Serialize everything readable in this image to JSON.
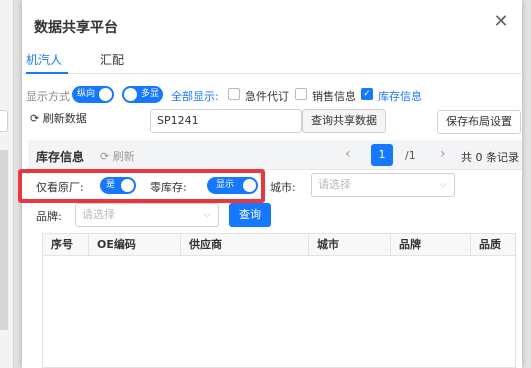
{
  "dialog": {
    "title": "数据共享平台",
    "close_icon": "close-icon"
  },
  "tabs": [
    {
      "label": "机汽人",
      "active": true
    },
    {
      "label": "汇配",
      "active": false
    }
  ],
  "display_options": {
    "mode_label": "显示方式",
    "mode_toggle": "纵向",
    "multi_toggle": "多显",
    "show_all": "全部显示:",
    "checkboxes": [
      {
        "label": "急件代订",
        "checked": false
      },
      {
        "label": "销售信息",
        "checked": false
      },
      {
        "label": "库存信息",
        "checked": true
      }
    ]
  },
  "toolbar": {
    "refresh_label": "刷新数据",
    "search_value": "SP1241",
    "query_label": "查询共享数据",
    "save_layout_label": "保存布局设置"
  },
  "inventory": {
    "title": "库存信息",
    "refresh_label": "刷新",
    "pagination": {
      "current": "1",
      "total": "/1",
      "summary": "共 0 条记录"
    },
    "filters": {
      "original_only_label": "仅看原厂:",
      "original_only_toggle": "是",
      "zero_stock_label": "零库存:",
      "zero_stock_toggle": "显示",
      "city_label": "城市:",
      "city_placeholder": "请选择",
      "brand_label": "品牌:",
      "brand_placeholder": "请选择",
      "search_button": "查询"
    },
    "columns": [
      "序号",
      "OE编码",
      "供应商",
      "城市",
      "品牌",
      "品质"
    ]
  },
  "colors": {
    "accent": "#1677ff",
    "highlight": "#e8383d"
  }
}
